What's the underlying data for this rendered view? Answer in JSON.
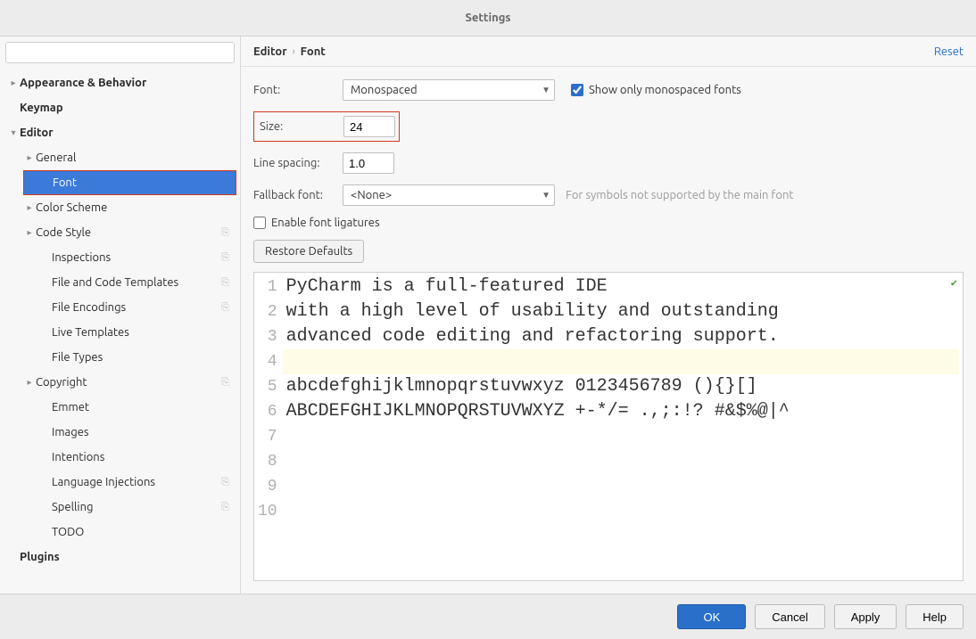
{
  "window": {
    "title": "Settings"
  },
  "sidebar": {
    "search_placeholder": "",
    "items": [
      {
        "label": "Appearance & Behavior",
        "depth": 0,
        "arrow": "▸",
        "bold": true
      },
      {
        "label": "Keymap",
        "depth": 0,
        "arrow": "",
        "bold": true
      },
      {
        "label": "Editor",
        "depth": 0,
        "arrow": "▾",
        "bold": true
      },
      {
        "label": "General",
        "depth": 1,
        "arrow": "▸"
      },
      {
        "label": "Font",
        "depth": 1,
        "arrow": "",
        "selected": true,
        "highlight": true
      },
      {
        "label": "Color Scheme",
        "depth": 1,
        "arrow": "▸"
      },
      {
        "label": "Code Style",
        "depth": 1,
        "arrow": "▸",
        "config": true
      },
      {
        "label": "Inspections",
        "depth": 2,
        "arrow": "",
        "config": true
      },
      {
        "label": "File and Code Templates",
        "depth": 2,
        "arrow": "",
        "config": true
      },
      {
        "label": "File Encodings",
        "depth": 2,
        "arrow": "",
        "config": true
      },
      {
        "label": "Live Templates",
        "depth": 2,
        "arrow": ""
      },
      {
        "label": "File Types",
        "depth": 2,
        "arrow": ""
      },
      {
        "label": "Copyright",
        "depth": 1,
        "arrow": "▸",
        "config": true
      },
      {
        "label": "Emmet",
        "depth": 2,
        "arrow": ""
      },
      {
        "label": "Images",
        "depth": 2,
        "arrow": ""
      },
      {
        "label": "Intentions",
        "depth": 2,
        "arrow": ""
      },
      {
        "label": "Language Injections",
        "depth": 2,
        "arrow": "",
        "config": true
      },
      {
        "label": "Spelling",
        "depth": 2,
        "arrow": "",
        "config": true
      },
      {
        "label": "TODO",
        "depth": 2,
        "arrow": ""
      },
      {
        "label": "Plugins",
        "depth": 0,
        "arrow": "",
        "bold": true
      }
    ]
  },
  "breadcrumb": {
    "root": "Editor",
    "leaf": "Font",
    "reset": "Reset"
  },
  "form": {
    "font_label": "Font:",
    "font_value": "Monospaced",
    "mono_only_label": "Show only monospaced fonts",
    "mono_only_checked": true,
    "size_label": "Size:",
    "size_value": "24",
    "linespacing_label": "Line spacing:",
    "linespacing_value": "1.0",
    "fallback_label": "Fallback font:",
    "fallback_value": "<None>",
    "fallback_hint": "For symbols not supported by the main font",
    "ligatures_label": "Enable font ligatures",
    "ligatures_checked": false,
    "restore_label": "Restore Defaults"
  },
  "preview": {
    "lines": [
      "PyCharm is a full-featured IDE",
      "with a high level of usability and outstanding",
      "advanced code editing and refactoring support.",
      "",
      "abcdefghijklmnopqrstuvwxyz 0123456789 (){}[]",
      "ABCDEFGHIJKLMNOPQRSTUVWXYZ +-*/= .,;:!? #&$%@|^",
      "",
      "",
      "",
      ""
    ],
    "highlight_line": 3
  },
  "buttons": {
    "ok": "OK",
    "cancel": "Cancel",
    "apply": "Apply",
    "help": "Help"
  }
}
